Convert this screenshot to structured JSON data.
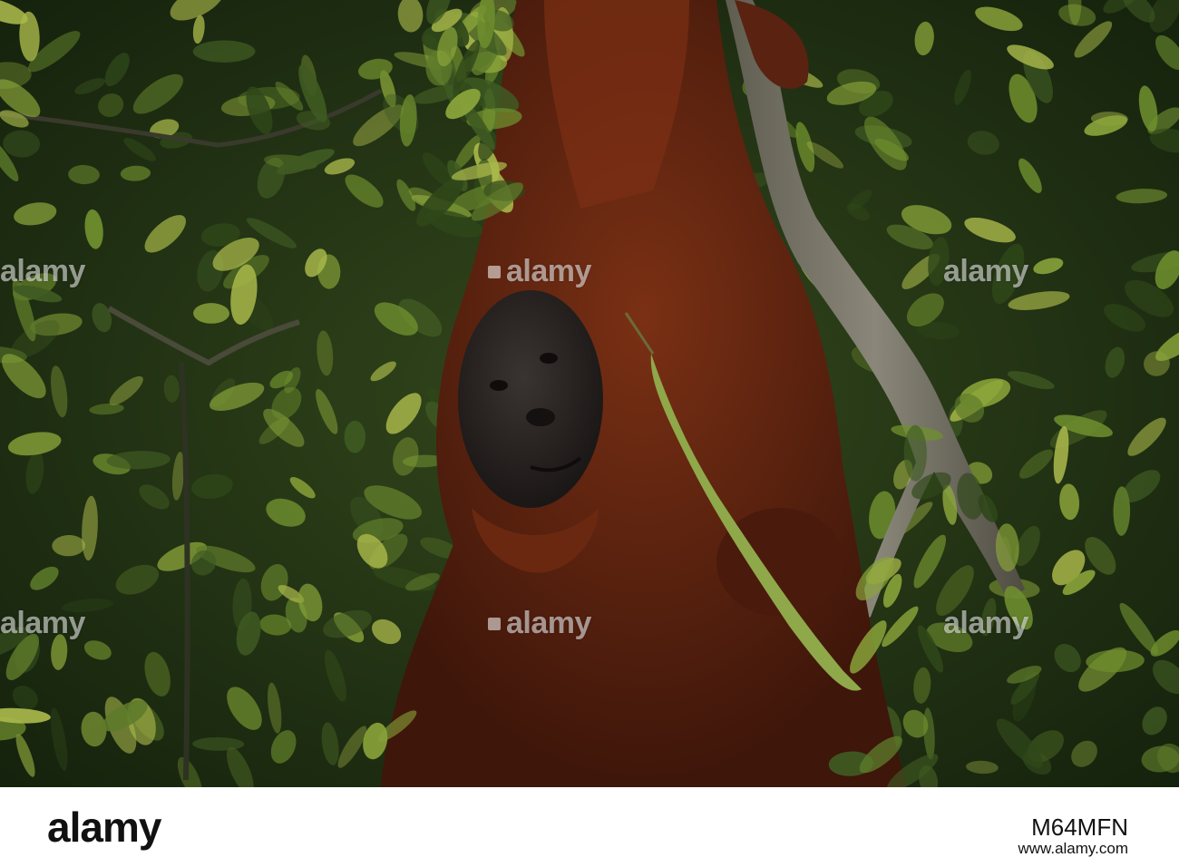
{
  "photo": {
    "subject": "orangutan-hanging-in-tree",
    "colors": {
      "foliage_dark": "#1b2a12",
      "foliage_mid": "#3f5a22",
      "foliage_light": "#8aa43a",
      "fur": "#6b2a12",
      "fur_light": "#8c3a18",
      "face": "#2a2624",
      "branch": "#7d7a6a",
      "pod": "#8fa84a"
    }
  },
  "watermark": {
    "text": "alamy"
  },
  "footer": {
    "logo": "alamy",
    "image_id": "M64MFN",
    "url": "www.alamy.com"
  }
}
